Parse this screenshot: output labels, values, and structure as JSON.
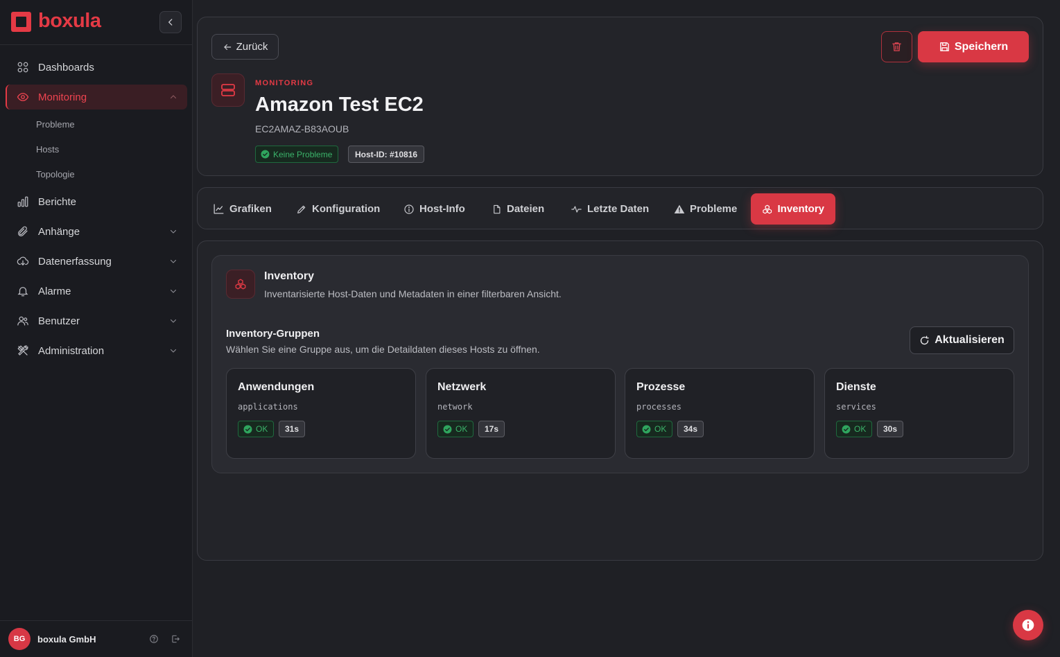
{
  "brand": {
    "name": "boxula",
    "accent": "#e43a45"
  },
  "sidebar": {
    "items": [
      {
        "label": "Dashboards",
        "icon": "grid-icon"
      },
      {
        "label": "Monitoring",
        "icon": "eye-icon",
        "active": true,
        "children": [
          "Probleme",
          "Hosts",
          "Topologie"
        ]
      },
      {
        "label": "Berichte",
        "icon": "bar-chart-icon"
      },
      {
        "label": "Anhänge",
        "icon": "paperclip-icon"
      },
      {
        "label": "Datenerfassung",
        "icon": "cloud-download-icon"
      },
      {
        "label": "Alarme",
        "icon": "bell-icon"
      },
      {
        "label": "Benutzer",
        "icon": "users-icon"
      },
      {
        "label": "Administration",
        "icon": "tools-icon"
      }
    ],
    "footer": {
      "initials": "BG",
      "org": "boxula GmbH"
    }
  },
  "header": {
    "back_label": "Zurück",
    "save_label": "Speichern",
    "eyebrow": "MONITORING",
    "title": "Amazon Test EC2",
    "subtitle": "EC2AMAZ-B83AOUB",
    "status_badge": "Keine Probleme",
    "host_id": "Host-ID: #10816"
  },
  "tabs": [
    {
      "label": "Grafiken",
      "icon": "line-chart-icon"
    },
    {
      "label": "Konfiguration",
      "icon": "pencil-icon"
    },
    {
      "label": "Host-Info",
      "icon": "info-icon"
    },
    {
      "label": "Dateien",
      "icon": "file-icon"
    },
    {
      "label": "Letzte Daten",
      "icon": "activity-icon"
    },
    {
      "label": "Probleme",
      "icon": "warning-icon"
    },
    {
      "label": "Inventory",
      "icon": "boxes-icon",
      "active": true
    }
  ],
  "inventory": {
    "title": "Inventory",
    "description": "Inventarisierte Host-Daten und Metadaten in einer filterbaren Ansicht.",
    "groups_title": "Inventory-Gruppen",
    "groups_description": "Wählen Sie eine Gruppe aus, um die Detaildaten dieses Hosts zu öffnen.",
    "refresh_label": "Aktualisieren",
    "groups": [
      {
        "name": "Anwendungen",
        "key": "applications",
        "status": "OK",
        "age": "31s"
      },
      {
        "name": "Netzwerk",
        "key": "network",
        "status": "OK",
        "age": "17s"
      },
      {
        "name": "Prozesse",
        "key": "processes",
        "status": "OK",
        "age": "34s"
      },
      {
        "name": "Dienste",
        "key": "services",
        "status": "OK",
        "age": "30s"
      }
    ]
  }
}
